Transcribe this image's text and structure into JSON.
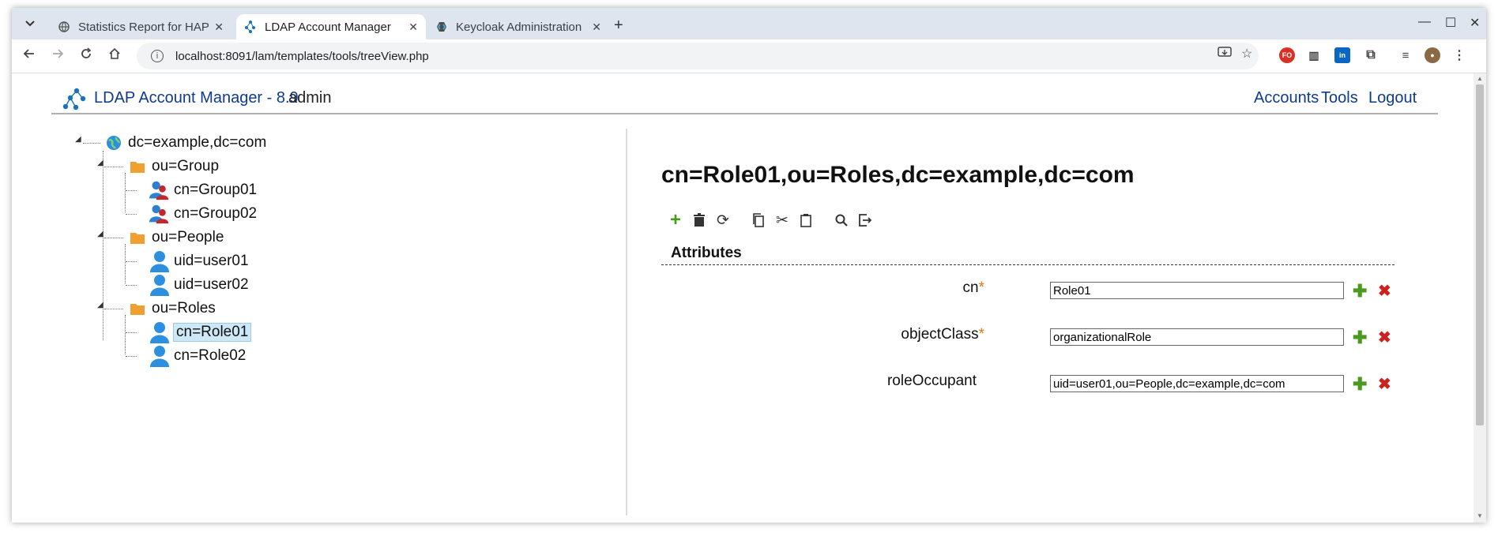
{
  "browser": {
    "tabs": [
      {
        "title": "Statistics Report for HAP",
        "active": false
      },
      {
        "title": "LDAP Account Manager",
        "active": true
      },
      {
        "title": "Keycloak Administration",
        "active": false
      }
    ],
    "url": "localhost:8091/lam/templates/tools/treeView.php"
  },
  "lam": {
    "title": "LDAP Account Manager - 8.9",
    "user": "admin",
    "nav": [
      "Accounts",
      "Tools",
      "Logout"
    ]
  },
  "tree": {
    "root": "dc=example,dc=com",
    "groups": [
      {
        "label": "ou=Group",
        "children": [
          "cn=Group01",
          "cn=Group02"
        ]
      },
      {
        "label": "ou=People",
        "children": [
          "uid=user01",
          "uid=user02"
        ]
      },
      {
        "label": "ou=Roles",
        "children": [
          "cn=Role01",
          "cn=Role02"
        ]
      }
    ],
    "selected": "cn=Role01"
  },
  "detail": {
    "dn": "cn=Role01,ou=Roles,dc=example,dc=com",
    "section": "Attributes",
    "attributes": [
      {
        "name": "cn",
        "required": true,
        "value": "Role01"
      },
      {
        "name": "objectClass",
        "required": true,
        "value": "organizationalRole"
      },
      {
        "name": "roleOccupant",
        "required": false,
        "value": "uid=user01,ou=People,dc=example,dc=com"
      }
    ],
    "required_mark": "*"
  },
  "colors": {
    "link": "#0e3b8c",
    "required": "#e07a10",
    "add": "#4a9a1f",
    "delete": "#cc2222",
    "selected_bg": "#cde8f7"
  }
}
